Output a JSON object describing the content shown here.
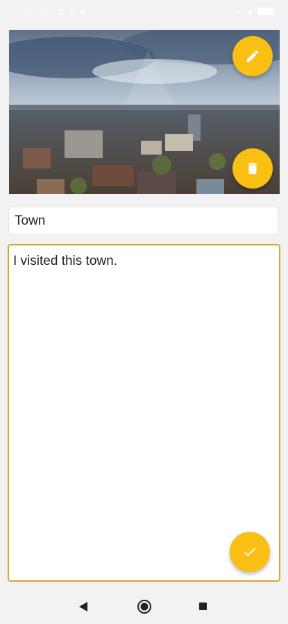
{
  "status_bar": {
    "time": "5:47 PM",
    "battery": "85",
    "icons": [
      "at-sign-icon",
      "copyright-icon",
      "navigation-icon",
      "more-icon",
      "wifi-icon",
      "signal-icon",
      "battery-icon"
    ]
  },
  "note": {
    "title_value": "Town",
    "body_value": "I visited this town."
  },
  "actions": {
    "edit_icon": "pencil-icon",
    "delete_icon": "trash-icon",
    "save_icon": "check-icon"
  },
  "colors": {
    "accent": "#f9c013",
    "focus_border": "#d6a72a",
    "background": "#f2f2f2"
  },
  "nav": {
    "back_icon": "back-triangle-icon",
    "home_icon": "home-circle-icon",
    "recents_icon": "recents-square-icon"
  }
}
